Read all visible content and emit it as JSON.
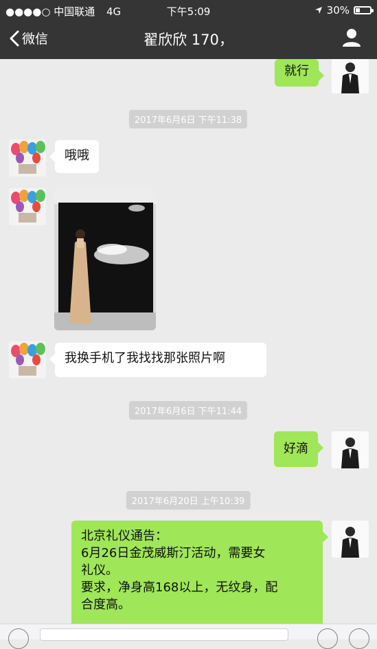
{
  "status": {
    "carrier": "●●●●○ 中国联通",
    "network": "4G",
    "time": "下午5:09",
    "battery": "30%",
    "battery_level": 0.3
  },
  "nav": {
    "back_label": "微信",
    "title": "翟欣欣 170，"
  },
  "messages": {
    "m1": "就行",
    "t1": "2017年6月6日 下午11:38",
    "m2": "哦哦",
    "m4": "我换手机了我找找那张照片啊",
    "t2": "2017年6月6日 下午11:44",
    "m5": "好滴",
    "t3": "2017年6月20日 上午10:39",
    "m6_line1": "北京礼仪通告：",
    "m6_line2": "6月26日金茂威斯汀活动，需要女",
    "m6_line3": "礼仪。",
    "m6_line4": "要求，净身高168以上，无纹身，配",
    "m6_line5": "合度高。"
  },
  "colors": {
    "header": "#353535",
    "background": "#ebebeb",
    "sent_bubble": "#9fe658",
    "received_bubble": "#ffffff"
  }
}
